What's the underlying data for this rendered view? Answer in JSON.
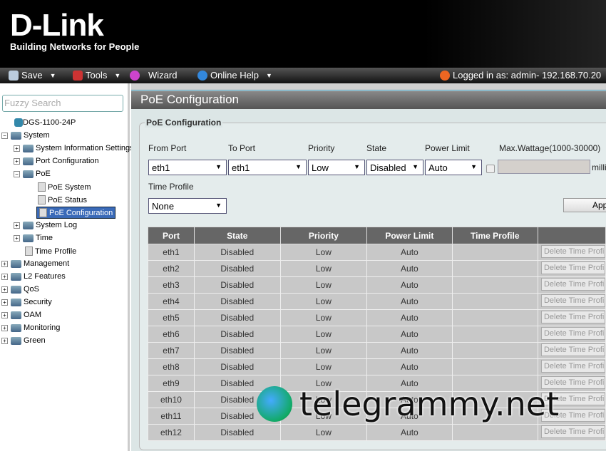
{
  "header": {
    "brand": "D-Link",
    "tagline": "Building Networks for People"
  },
  "toolbar": {
    "save": "Save",
    "tools": "Tools",
    "wizard": "Wizard",
    "help": "Online Help",
    "logged_in": "Logged in as: admin- 192.168.70.20"
  },
  "sidebar": {
    "search_placeholder": "Fuzzy Search",
    "device": "DGS-1100-24P",
    "items": [
      "System",
      "System Information Settings",
      "Port Configuration",
      "PoE",
      "PoE System",
      "PoE Status",
      "PoE Configuration",
      "System Log",
      "Time",
      "Time Profile",
      "Management",
      "L2 Features",
      "QoS",
      "Security",
      "OAM",
      "Monitoring",
      "Green"
    ]
  },
  "page": {
    "title": "PoE Configuration",
    "section": "PoE Configuration",
    "labels": {
      "from_port": "From Port",
      "to_port": "To Port",
      "priority": "Priority",
      "state": "State",
      "power_limit": "Power Limit",
      "max_wattage": "Max.Wattage(1000-30000)",
      "time_profile": "Time Profile",
      "unit": "milli"
    },
    "values": {
      "from_port": "eth1",
      "to_port": "eth1",
      "priority": "Low",
      "state": "Disabled",
      "power_limit": "Auto",
      "time_profile": "None"
    },
    "apply": "Apply"
  },
  "table": {
    "headers": [
      "Port",
      "State",
      "Priority",
      "Power Limit",
      "Time Profile",
      ""
    ],
    "delete_label": "Delete Time Profile",
    "rows": [
      [
        "eth1",
        "Disabled",
        "Low",
        "Auto",
        ""
      ],
      [
        "eth2",
        "Disabled",
        "Low",
        "Auto",
        ""
      ],
      [
        "eth3",
        "Disabled",
        "Low",
        "Auto",
        ""
      ],
      [
        "eth4",
        "Disabled",
        "Low",
        "Auto",
        ""
      ],
      [
        "eth5",
        "Disabled",
        "Low",
        "Auto",
        ""
      ],
      [
        "eth6",
        "Disabled",
        "Low",
        "Auto",
        ""
      ],
      [
        "eth7",
        "Disabled",
        "Low",
        "Auto",
        ""
      ],
      [
        "eth8",
        "Disabled",
        "Low",
        "Auto",
        ""
      ],
      [
        "eth9",
        "Disabled",
        "Low",
        "Auto",
        ""
      ],
      [
        "eth10",
        "Disabled",
        "Low",
        "Auto",
        ""
      ],
      [
        "eth11",
        "Disabled",
        "Low",
        "Auto",
        ""
      ],
      [
        "eth12",
        "Disabled",
        "Low",
        "Auto",
        ""
      ]
    ]
  },
  "watermark": "telegrammy.net"
}
